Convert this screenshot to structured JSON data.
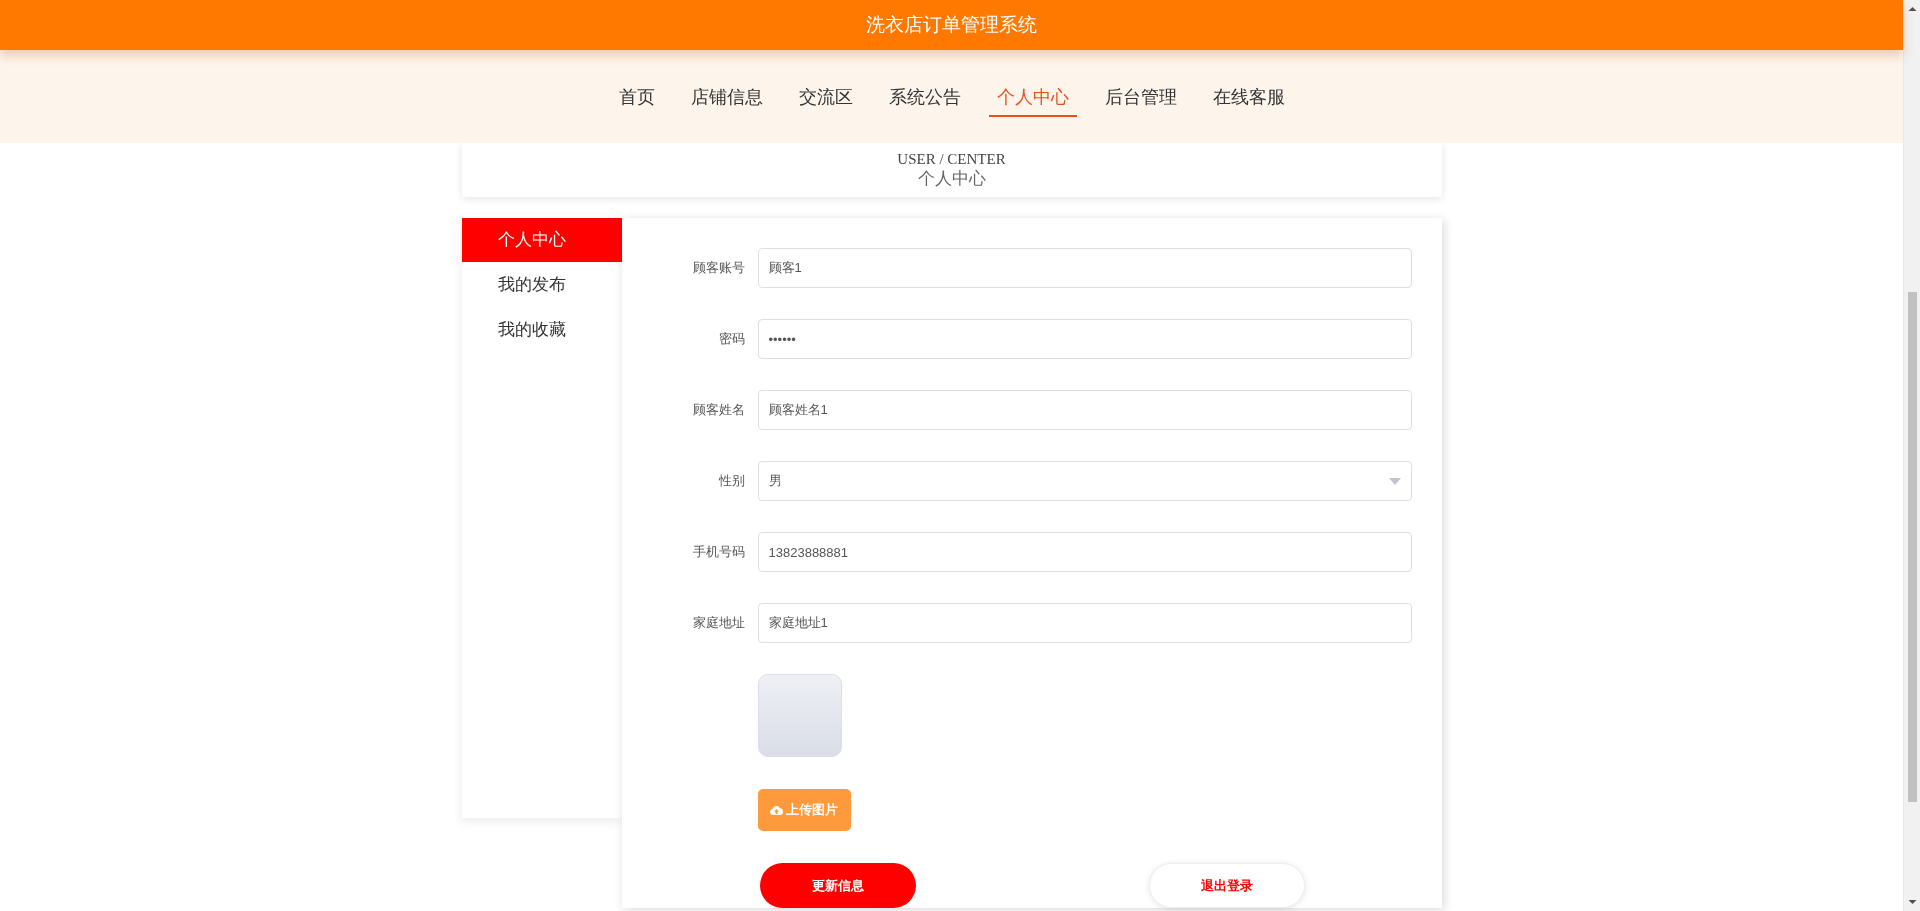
{
  "header": {
    "title": "洗衣店订单管理系统"
  },
  "nav": [
    {
      "label": "首页",
      "selected": false
    },
    {
      "label": "店铺信息",
      "selected": false
    },
    {
      "label": "交流区",
      "selected": false
    },
    {
      "label": "系统公告",
      "selected": false
    },
    {
      "label": "个人中心",
      "selected": true
    },
    {
      "label": "后台管理",
      "selected": false
    },
    {
      "label": "在线客服",
      "selected": false
    }
  ],
  "title_card": {
    "subtitle_en": "USER / CENTER",
    "title": "个人中心"
  },
  "sidebar": {
    "items": [
      {
        "label": "个人中心",
        "selected": true
      },
      {
        "label": "我的发布",
        "selected": false
      },
      {
        "label": "我的收藏",
        "selected": false
      }
    ]
  },
  "form": {
    "fields": [
      {
        "kind": "text",
        "label": "顾客账号",
        "value": "顾客1"
      },
      {
        "kind": "password",
        "label": "密码",
        "value": "••••••"
      },
      {
        "kind": "text",
        "label": "顾客姓名",
        "value": "顾客姓名1"
      },
      {
        "kind": "select",
        "label": "性别",
        "value": "男"
      },
      {
        "kind": "text",
        "label": "手机号码",
        "value": "13823888881"
      },
      {
        "kind": "text",
        "label": "家庭地址",
        "value": "家庭地址1"
      }
    ],
    "upload_button": "上传图片",
    "buttons": [
      {
        "kind": "primary",
        "label": "更新信息"
      },
      {
        "kind": "secondary",
        "label": "退出登录"
      }
    ]
  }
}
